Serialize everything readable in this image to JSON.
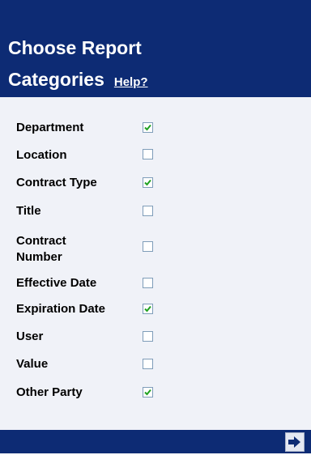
{
  "header": {
    "title_line1": "Choose Report",
    "title_line2": "Categories",
    "help_label": "Help?"
  },
  "categories": [
    {
      "label": "Department",
      "checked": true
    },
    {
      "label": "Location",
      "checked": false
    },
    {
      "label": "Contract Type",
      "checked": true
    },
    {
      "label": "Title",
      "checked": false
    },
    {
      "label_line1": "Contract",
      "label_line2": "Number",
      "checked": false
    },
    {
      "label": "Effective Date",
      "checked": false
    },
    {
      "label": "Expiration Date",
      "checked": true
    },
    {
      "label": "User",
      "checked": false
    },
    {
      "label": "Value",
      "checked": false
    },
    {
      "label": "Other Party",
      "checked": true
    }
  ],
  "footer": {
    "next_icon": "arrow-right-icon"
  },
  "colors": {
    "header_bg": "#0d2b74",
    "panel_bg": "#f0f2f8",
    "check_color": "#21a121"
  }
}
